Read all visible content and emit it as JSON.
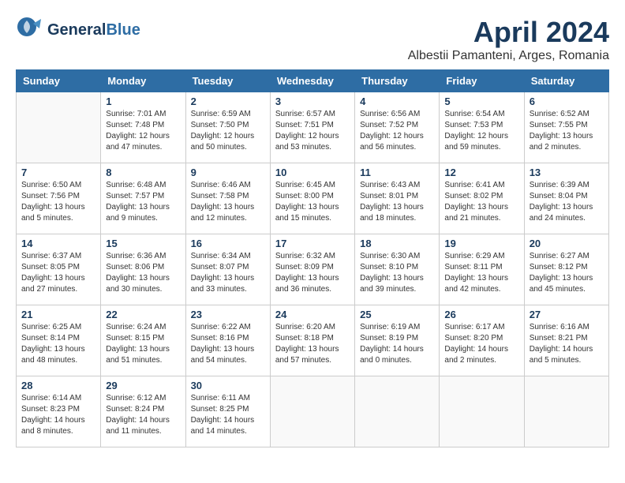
{
  "header": {
    "logo_line1": "General",
    "logo_line2": "Blue",
    "month_title": "April 2024",
    "location": "Albestii Pamanteni, Arges, Romania"
  },
  "weekdays": [
    "Sunday",
    "Monday",
    "Tuesday",
    "Wednesday",
    "Thursday",
    "Friday",
    "Saturday"
  ],
  "weeks": [
    [
      {
        "day": "",
        "info": ""
      },
      {
        "day": "1",
        "info": "Sunrise: 7:01 AM\nSunset: 7:48 PM\nDaylight: 12 hours\nand 47 minutes."
      },
      {
        "day": "2",
        "info": "Sunrise: 6:59 AM\nSunset: 7:50 PM\nDaylight: 12 hours\nand 50 minutes."
      },
      {
        "day": "3",
        "info": "Sunrise: 6:57 AM\nSunset: 7:51 PM\nDaylight: 12 hours\nand 53 minutes."
      },
      {
        "day": "4",
        "info": "Sunrise: 6:56 AM\nSunset: 7:52 PM\nDaylight: 12 hours\nand 56 minutes."
      },
      {
        "day": "5",
        "info": "Sunrise: 6:54 AM\nSunset: 7:53 PM\nDaylight: 12 hours\nand 59 minutes."
      },
      {
        "day": "6",
        "info": "Sunrise: 6:52 AM\nSunset: 7:55 PM\nDaylight: 13 hours\nand 2 minutes."
      }
    ],
    [
      {
        "day": "7",
        "info": "Sunrise: 6:50 AM\nSunset: 7:56 PM\nDaylight: 13 hours\nand 5 minutes."
      },
      {
        "day": "8",
        "info": "Sunrise: 6:48 AM\nSunset: 7:57 PM\nDaylight: 13 hours\nand 9 minutes."
      },
      {
        "day": "9",
        "info": "Sunrise: 6:46 AM\nSunset: 7:58 PM\nDaylight: 13 hours\nand 12 minutes."
      },
      {
        "day": "10",
        "info": "Sunrise: 6:45 AM\nSunset: 8:00 PM\nDaylight: 13 hours\nand 15 minutes."
      },
      {
        "day": "11",
        "info": "Sunrise: 6:43 AM\nSunset: 8:01 PM\nDaylight: 13 hours\nand 18 minutes."
      },
      {
        "day": "12",
        "info": "Sunrise: 6:41 AM\nSunset: 8:02 PM\nDaylight: 13 hours\nand 21 minutes."
      },
      {
        "day": "13",
        "info": "Sunrise: 6:39 AM\nSunset: 8:04 PM\nDaylight: 13 hours\nand 24 minutes."
      }
    ],
    [
      {
        "day": "14",
        "info": "Sunrise: 6:37 AM\nSunset: 8:05 PM\nDaylight: 13 hours\nand 27 minutes."
      },
      {
        "day": "15",
        "info": "Sunrise: 6:36 AM\nSunset: 8:06 PM\nDaylight: 13 hours\nand 30 minutes."
      },
      {
        "day": "16",
        "info": "Sunrise: 6:34 AM\nSunset: 8:07 PM\nDaylight: 13 hours\nand 33 minutes."
      },
      {
        "day": "17",
        "info": "Sunrise: 6:32 AM\nSunset: 8:09 PM\nDaylight: 13 hours\nand 36 minutes."
      },
      {
        "day": "18",
        "info": "Sunrise: 6:30 AM\nSunset: 8:10 PM\nDaylight: 13 hours\nand 39 minutes."
      },
      {
        "day": "19",
        "info": "Sunrise: 6:29 AM\nSunset: 8:11 PM\nDaylight: 13 hours\nand 42 minutes."
      },
      {
        "day": "20",
        "info": "Sunrise: 6:27 AM\nSunset: 8:12 PM\nDaylight: 13 hours\nand 45 minutes."
      }
    ],
    [
      {
        "day": "21",
        "info": "Sunrise: 6:25 AM\nSunset: 8:14 PM\nDaylight: 13 hours\nand 48 minutes."
      },
      {
        "day": "22",
        "info": "Sunrise: 6:24 AM\nSunset: 8:15 PM\nDaylight: 13 hours\nand 51 minutes."
      },
      {
        "day": "23",
        "info": "Sunrise: 6:22 AM\nSunset: 8:16 PM\nDaylight: 13 hours\nand 54 minutes."
      },
      {
        "day": "24",
        "info": "Sunrise: 6:20 AM\nSunset: 8:18 PM\nDaylight: 13 hours\nand 57 minutes."
      },
      {
        "day": "25",
        "info": "Sunrise: 6:19 AM\nSunset: 8:19 PM\nDaylight: 14 hours\nand 0 minutes."
      },
      {
        "day": "26",
        "info": "Sunrise: 6:17 AM\nSunset: 8:20 PM\nDaylight: 14 hours\nand 2 minutes."
      },
      {
        "day": "27",
        "info": "Sunrise: 6:16 AM\nSunset: 8:21 PM\nDaylight: 14 hours\nand 5 minutes."
      }
    ],
    [
      {
        "day": "28",
        "info": "Sunrise: 6:14 AM\nSunset: 8:23 PM\nDaylight: 14 hours\nand 8 minutes."
      },
      {
        "day": "29",
        "info": "Sunrise: 6:12 AM\nSunset: 8:24 PM\nDaylight: 14 hours\nand 11 minutes."
      },
      {
        "day": "30",
        "info": "Sunrise: 6:11 AM\nSunset: 8:25 PM\nDaylight: 14 hours\nand 14 minutes."
      },
      {
        "day": "",
        "info": ""
      },
      {
        "day": "",
        "info": ""
      },
      {
        "day": "",
        "info": ""
      },
      {
        "day": "",
        "info": ""
      }
    ]
  ]
}
